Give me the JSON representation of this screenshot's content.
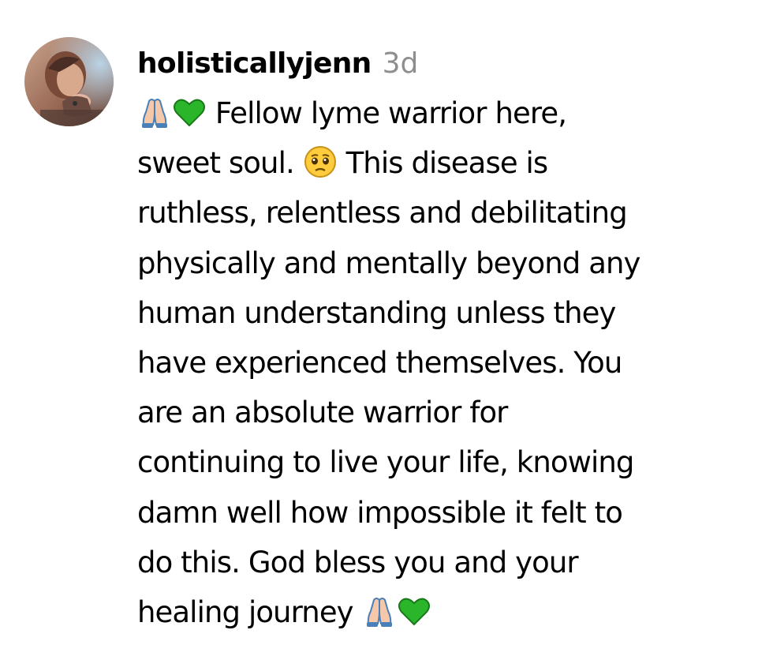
{
  "comment": {
    "username": "holisticallyjenn",
    "timestamp": "3d",
    "lines": [
      {
        "pre_emojis": [
          "folded-hands",
          "green-heart"
        ],
        "text": "Fellow lyme warrior here,"
      },
      {
        "text_before": "sweet soul.",
        "inline_emoji": "pleading-face",
        "text_after": "This disease is"
      },
      {
        "text": "ruthless, relentless and debilitating"
      },
      {
        "text": "physically and mentally beyond any"
      },
      {
        "text": "human understanding unless they"
      },
      {
        "text": "have experienced themselves. You"
      },
      {
        "text": "are an absolute warrior for"
      },
      {
        "text": "continuing to live your life, knowing"
      },
      {
        "text": "damn well how impossible it felt to"
      },
      {
        "text": "do this. God bless you and your"
      },
      {
        "text": "healing journey",
        "post_emojis": [
          "folded-hands",
          "green-heart"
        ]
      }
    ]
  },
  "colors": {
    "text": "#000000",
    "timestamp": "#8e8e8e",
    "green_heart": "#2bb52b",
    "emoji_face": "#ffcc3d"
  }
}
